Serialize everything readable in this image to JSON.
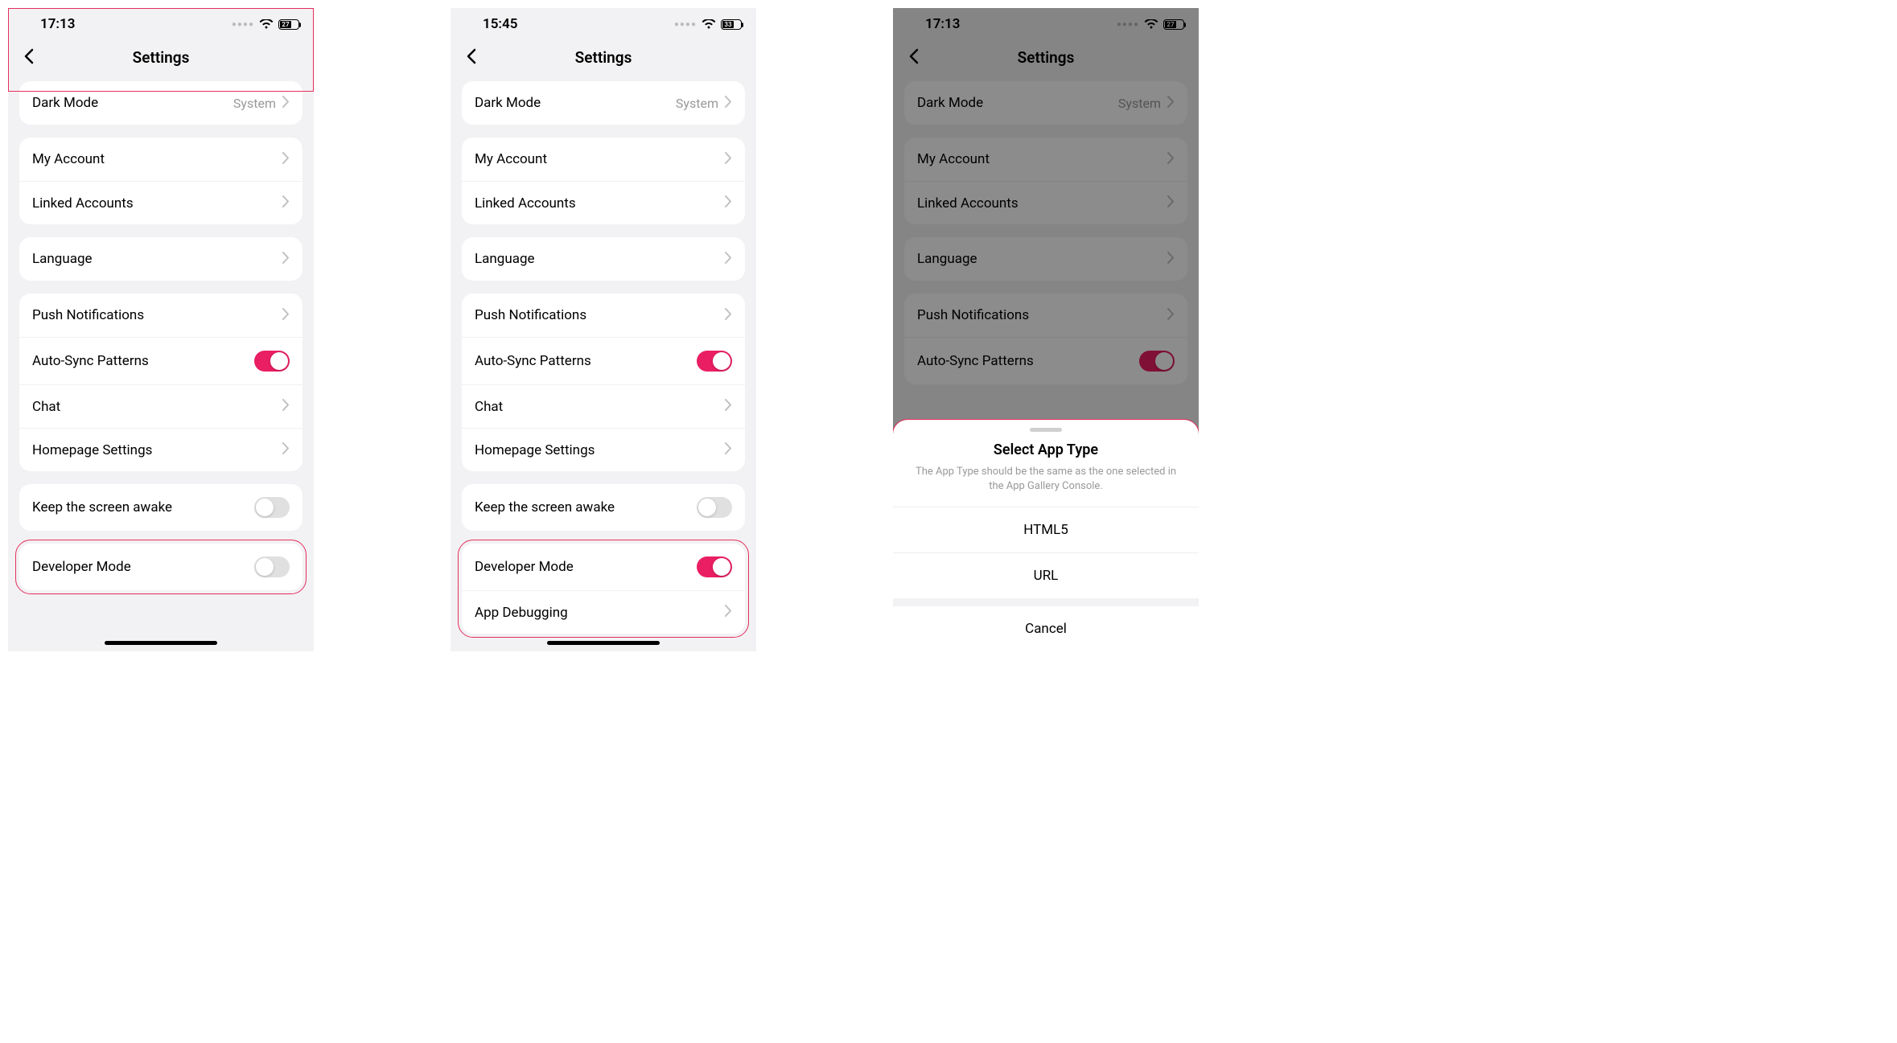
{
  "screens": [
    {
      "time": "17:13",
      "battery": "27",
      "title": "Settings",
      "highlightHeader": true,
      "groups": [
        {
          "rows": [
            {
              "label": "Dark Mode",
              "value": "System",
              "kind": "nav"
            }
          ]
        },
        {
          "rows": [
            {
              "label": "My Account",
              "kind": "nav"
            },
            {
              "label": "Linked Accounts",
              "kind": "nav"
            }
          ]
        },
        {
          "rows": [
            {
              "label": "Language",
              "kind": "nav"
            }
          ]
        },
        {
          "rows": [
            {
              "label": "Push Notifications",
              "kind": "nav"
            },
            {
              "label": "Auto-Sync Patterns",
              "kind": "toggle",
              "on": true
            },
            {
              "label": "Chat",
              "kind": "nav"
            },
            {
              "label": "Homepage Settings",
              "kind": "nav"
            }
          ]
        },
        {
          "rows": [
            {
              "label": "Keep the screen awake",
              "kind": "toggle",
              "on": false
            }
          ]
        },
        {
          "highlight": true,
          "rows": [
            {
              "label": "Developer Mode",
              "kind": "toggle",
              "on": false
            }
          ]
        }
      ]
    },
    {
      "time": "15:45",
      "battery": "33",
      "title": "Settings",
      "groups": [
        {
          "rows": [
            {
              "label": "Dark Mode",
              "value": "System",
              "kind": "nav"
            }
          ]
        },
        {
          "rows": [
            {
              "label": "My Account",
              "kind": "nav"
            },
            {
              "label": "Linked Accounts",
              "kind": "nav"
            }
          ]
        },
        {
          "rows": [
            {
              "label": "Language",
              "kind": "nav"
            }
          ]
        },
        {
          "rows": [
            {
              "label": "Push Notifications",
              "kind": "nav"
            },
            {
              "label": "Auto-Sync Patterns",
              "kind": "toggle",
              "on": true
            },
            {
              "label": "Chat",
              "kind": "nav"
            },
            {
              "label": "Homepage Settings",
              "kind": "nav"
            }
          ]
        },
        {
          "rows": [
            {
              "label": "Keep the screen awake",
              "kind": "toggle",
              "on": false
            }
          ]
        },
        {
          "highlight": true,
          "rows": [
            {
              "label": "Developer Mode",
              "kind": "toggle",
              "on": true
            },
            {
              "label": "App Debugging",
              "kind": "nav"
            }
          ]
        }
      ]
    },
    {
      "time": "17:13",
      "battery": "27",
      "title": "Settings",
      "dimmed": true,
      "groups": [
        {
          "rows": [
            {
              "label": "Dark Mode",
              "value": "System",
              "kind": "nav"
            }
          ]
        },
        {
          "rows": [
            {
              "label": "My Account",
              "kind": "nav"
            },
            {
              "label": "Linked Accounts",
              "kind": "nav"
            }
          ]
        },
        {
          "rows": [
            {
              "label": "Language",
              "kind": "nav"
            }
          ]
        },
        {
          "rows": [
            {
              "label": "Push Notifications",
              "kind": "nav"
            },
            {
              "label": "Auto-Sync Patterns",
              "kind": "toggle",
              "on": true
            }
          ]
        }
      ],
      "sheet": {
        "highlight": true,
        "title": "Select App Type",
        "subtitle": "The App Type should be the same as the one selected in the App Gallery Console.",
        "options": [
          "HTML5",
          "URL"
        ],
        "cancel": "Cancel"
      }
    }
  ]
}
